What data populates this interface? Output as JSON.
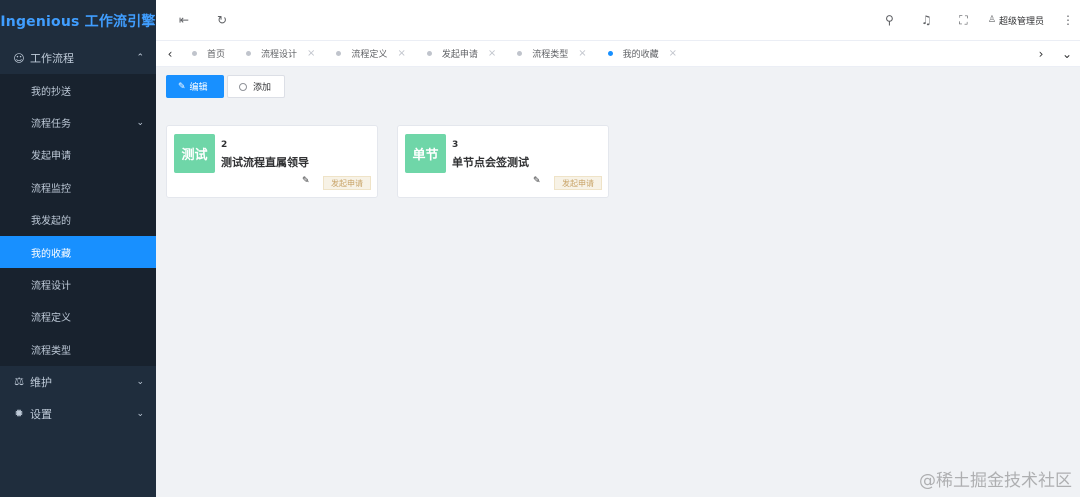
{
  "app": {
    "title": "Ingenious 工作流引擎"
  },
  "sidebar": {
    "groups": [
      {
        "icon": "☺",
        "label": "工作流程",
        "chevron": "⌃"
      },
      {
        "icon": "⚖",
        "label": "维护",
        "chevron": "⌄"
      },
      {
        "icon": "✹",
        "label": "设置",
        "chevron": "⌄"
      }
    ],
    "items": [
      {
        "label": "我的抄送"
      },
      {
        "label": "流程任务",
        "chevron": "⌄"
      },
      {
        "label": "发起申请"
      },
      {
        "label": "流程监控"
      },
      {
        "label": "我发起的"
      },
      {
        "label": "我的收藏"
      },
      {
        "label": "流程设计"
      },
      {
        "label": "流程定义"
      },
      {
        "label": "流程类型"
      }
    ]
  },
  "navbar": {
    "collapse_icon": "⇤",
    "refresh_icon": "↻",
    "search_icon": "⚲",
    "bell_icon": "♫",
    "fullscreen_icon": "⛶",
    "user_icon": "♙",
    "user_name": "超级管理员",
    "more_icon": "⋮"
  },
  "tags": {
    "prev_icon": "‹",
    "next_icon": "›",
    "dropdown_icon": "⌄",
    "close_icon": "×",
    "items": [
      {
        "label": "首页"
      },
      {
        "label": "流程设计"
      },
      {
        "label": "流程定义"
      },
      {
        "label": "发起申请"
      },
      {
        "label": "流程类型"
      },
      {
        "label": "我的收藏"
      }
    ]
  },
  "toolbar": {
    "edit_icon": "✎",
    "edit_label": "编辑",
    "add_label": "添加"
  },
  "cards": [
    {
      "badge": "测试",
      "number": "2",
      "title": "测试流程直属领导",
      "pencil": "✎",
      "status": "发起申请"
    },
    {
      "badge": "单节",
      "number": "3",
      "title": "单节点会签测试",
      "pencil": "✎",
      "status": "发起申请"
    }
  ],
  "watermark": "@稀土掘金技术社区",
  "colors": {
    "sidebar_bg": "#1f2d3d",
    "active": "#1890ff",
    "badge": "#6fd6a8",
    "brand": "#409eff"
  }
}
